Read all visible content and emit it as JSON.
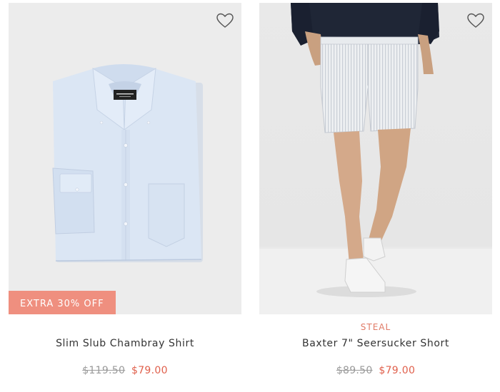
{
  "products": [
    {
      "name": "Slim Slub Chambray Shirt",
      "badge": "EXTRA 30% OFF",
      "tag": "",
      "price_original": "$119.50",
      "price_sale": "$79.00",
      "image": "folded-light-blue-shirt",
      "wishlist_icon": "heart-outline-icon"
    },
    {
      "name": "Baxter 7\" Seersucker Short",
      "badge": "",
      "tag": "STEAL",
      "price_original": "$89.50",
      "price_sale": "$79.00",
      "image": "model-wearing-seersucker-shorts",
      "wishlist_icon": "heart-outline-icon"
    }
  ],
  "colors": {
    "badge_bg": "#ef8f7f",
    "tag_text": "#e07a66",
    "sale_price": "#e0604c",
    "original_price": "#9a9a9a",
    "image_bg": "#ececec"
  }
}
